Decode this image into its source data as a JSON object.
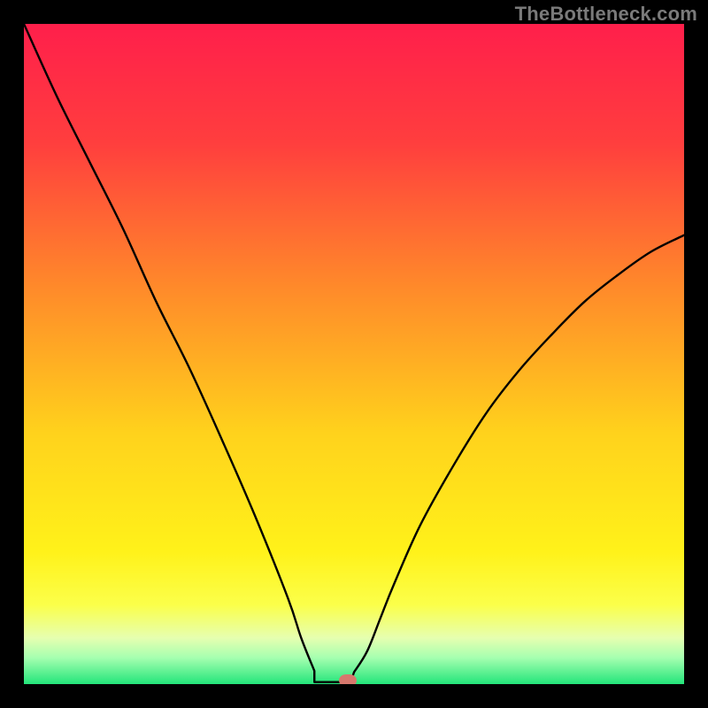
{
  "watermark": "TheBottleneck.com",
  "chart_data": {
    "type": "line",
    "title": "",
    "xlabel": "",
    "ylabel": "",
    "xlim": [
      0,
      100
    ],
    "ylim": [
      0,
      100
    ],
    "gradient_stops": [
      {
        "pct": 0,
        "color": "#ff1f4b"
      },
      {
        "pct": 18,
        "color": "#ff3e3e"
      },
      {
        "pct": 40,
        "color": "#ff8a2a"
      },
      {
        "pct": 62,
        "color": "#ffd21c"
      },
      {
        "pct": 80,
        "color": "#fff21a"
      },
      {
        "pct": 88,
        "color": "#fbff4a"
      },
      {
        "pct": 93,
        "color": "#e6ffb0"
      },
      {
        "pct": 96,
        "color": "#a6ffb0"
      },
      {
        "pct": 100,
        "color": "#23e57a"
      }
    ],
    "series": [
      {
        "name": "bottleneck-curve",
        "x": [
          0,
          5,
          10,
          15,
          20,
          25,
          30,
          35,
          40,
          42,
          44,
          46,
          48,
          50,
          52,
          54,
          56,
          60,
          65,
          70,
          75,
          80,
          85,
          90,
          95,
          100
        ],
        "y": [
          100,
          89,
          79,
          69,
          58,
          48,
          37,
          25.5,
          13,
          7,
          2,
          0.3,
          0.3,
          1.8,
          5,
          10,
          15,
          24,
          33,
          41,
          47.5,
          53,
          58,
          62,
          65.5,
          68
        ]
      }
    ],
    "flat_bottom": {
      "x0": 44,
      "x1": 49.5,
      "y": 0.3
    },
    "marker": {
      "x": 49,
      "y": 0.6,
      "color": "#d7786d"
    }
  }
}
